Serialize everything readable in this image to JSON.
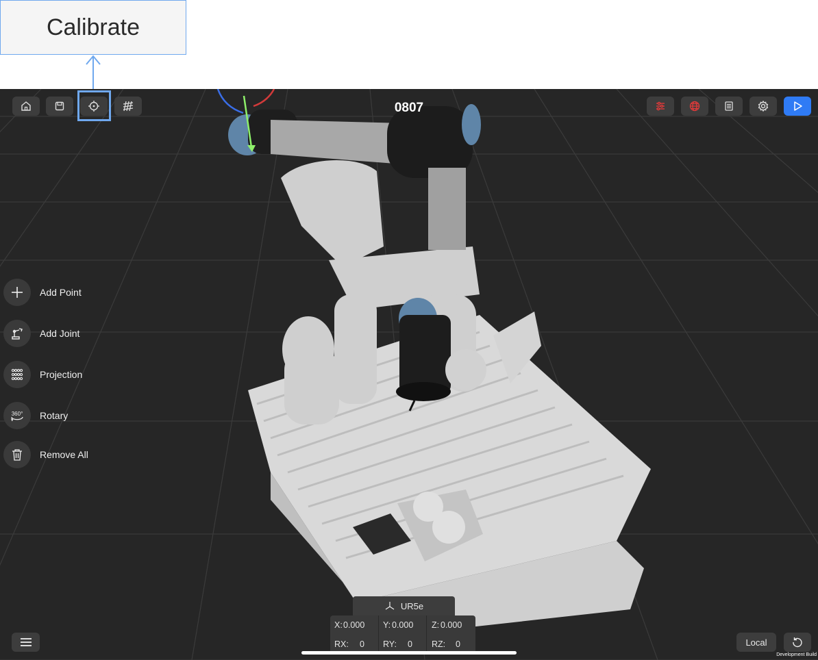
{
  "callout": {
    "label": "Calibrate"
  },
  "toolbar": {
    "title": "0807",
    "left_buttons": [
      "home-icon",
      "save-icon",
      "crosshair-icon",
      "grid-icon"
    ],
    "right_buttons": [
      "sliders-icon",
      "globe-icon",
      "notes-icon",
      "gear-icon",
      "play-icon"
    ],
    "accent": "#2f7bf5",
    "alert": "#e03a3a"
  },
  "side_menu": {
    "items": [
      {
        "label": "Add Point",
        "icon": "plus-icon"
      },
      {
        "label": "Add Joint",
        "icon": "robot-arm-icon"
      },
      {
        "label": "Projection",
        "icon": "dot-grid-icon"
      },
      {
        "label": "Rotary",
        "icon": "rotate-360-icon",
        "icon_text": "360°"
      },
      {
        "label": "Remove All",
        "icon": "trash-icon"
      }
    ]
  },
  "status": {
    "robot_name": "UR5e",
    "x_label": "X:",
    "x": "0.000",
    "y_label": "Y:",
    "y": "0.000",
    "z_label": "Z:",
    "z": "0.000",
    "rx_label": "RX:",
    "rx": "0",
    "ry_label": "RY:",
    "ry": "0",
    "rz_label": "RZ:",
    "rz": "0"
  },
  "bottom": {
    "frame_label": "Local",
    "build_label": "Development Build"
  }
}
